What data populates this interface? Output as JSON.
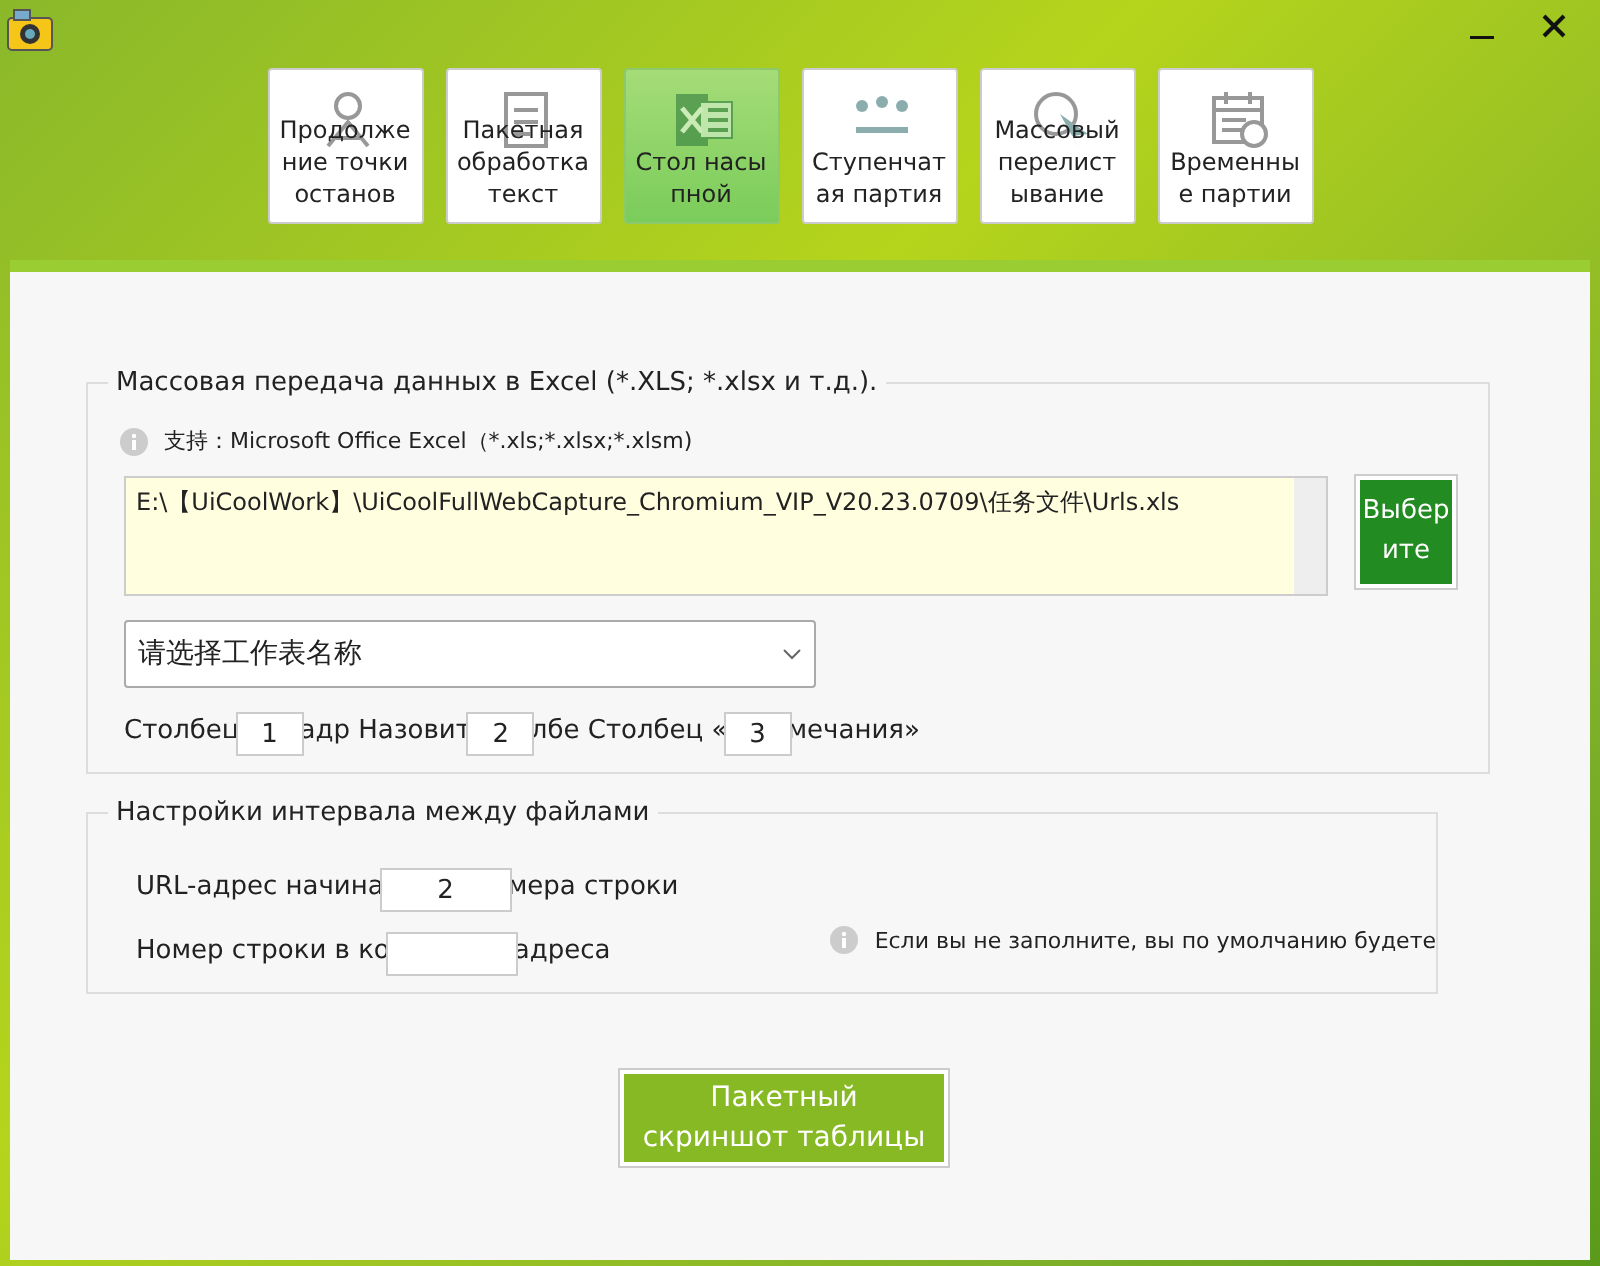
{
  "toolbar": [
    {
      "label": "Продолжение точки останов",
      "selected": false
    },
    {
      "label": "Пакетная обработка текст",
      "selected": false
    },
    {
      "label": "Стол насыпной",
      "selected": true
    },
    {
      "label": "Ступенчатая партия",
      "selected": false
    },
    {
      "label": "Массовый перелистывание",
      "selected": false
    },
    {
      "label": "Временные партии",
      "selected": false
    }
  ],
  "excel_section": {
    "title": "Массовая передача данных в Excel (*.XLS; *.xlsx и т.д.).",
    "support_note": "支持：Microsoft Office Excel（*.xls;*.xlsx;*.xlsm)",
    "file_path": "E:\\【UiCoolWork】\\UiCoolFullWebCapture_Chromium_VIP_V20.23.0709\\任务文件\\Urls.xls",
    "choose_button": "Выберите",
    "sheet_select": {
      "placeholder": "请选择工作表名称"
    },
    "columns_row": [
      {
        "kind": "text",
        "text": "Столбец"
      },
      {
        "kind": "input",
        "value": "1"
      },
      {
        "kind": "text",
        "text": "адр Назовит"
      },
      {
        "kind": "input",
        "value": "2"
      },
      {
        "kind": "text",
        "text": "лбе Столбец «"
      },
      {
        "kind": "input",
        "value": "3"
      },
      {
        "kind": "text",
        "text": "мечания»"
      }
    ]
  },
  "interval_section": {
    "title": "Настройки интервала между файлами",
    "rows": [
      [
        {
          "kind": "text",
          "text": "URL-адрес начина"
        },
        {
          "kind": "input",
          "value": "2"
        },
        {
          "kind": "text",
          "text": "мера строки"
        }
      ],
      [
        {
          "kind": "text",
          "text": "Номер строки в ко"
        },
        {
          "kind": "input"
        },
        {
          "kind": "text",
          "text": "адреса"
        }
      ]
    ],
    "hint": "Если вы не заполните, вы по умолчанию будете"
  },
  "action_button": "Пакетный скриншот таблицы"
}
